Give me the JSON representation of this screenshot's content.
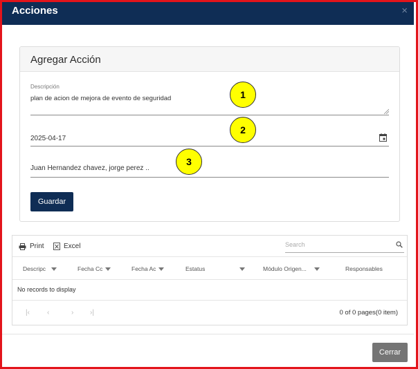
{
  "dialog": {
    "title": "Acciones",
    "close_glyph": "×"
  },
  "form": {
    "card_title": "Agregar Acción",
    "description_label": "Descripción",
    "description_value": "plan de acion de mejora de  evento de seguridad",
    "date_value": "2025-04-17",
    "responsables_value": "Juan Hernandez chavez, jorge perez ..",
    "save_label": "Guardar"
  },
  "markers": [
    "1",
    "2",
    "3"
  ],
  "grid": {
    "toolbar": {
      "print_label": "Print",
      "excel_label": "Excel",
      "search_placeholder": "Search"
    },
    "columns": [
      "Descripc",
      "Fecha Cc",
      "Fecha Ac",
      "Estatus",
      "Módulo Origen...",
      "Responsables"
    ],
    "empty_message": "No records to display",
    "pager": {
      "first": "|‹",
      "prev": "‹",
      "next": "›",
      "last": "›|",
      "info": "0 of 0 pages(0 item)"
    }
  },
  "footer": {
    "close_label": "Cerrar"
  },
  "colors": {
    "header_bg": "#0f2d55",
    "primary_button": "#0f2d55",
    "secondary_button": "#757575",
    "marker": "#ffff00",
    "frame_border": "#e3141b"
  },
  "icons": [
    "close-icon",
    "calendar-icon",
    "resize-handle-icon",
    "print-icon",
    "excel-icon",
    "search-icon",
    "filter-icon",
    "first-page-icon",
    "prev-page-icon",
    "next-page-icon",
    "last-page-icon"
  ]
}
